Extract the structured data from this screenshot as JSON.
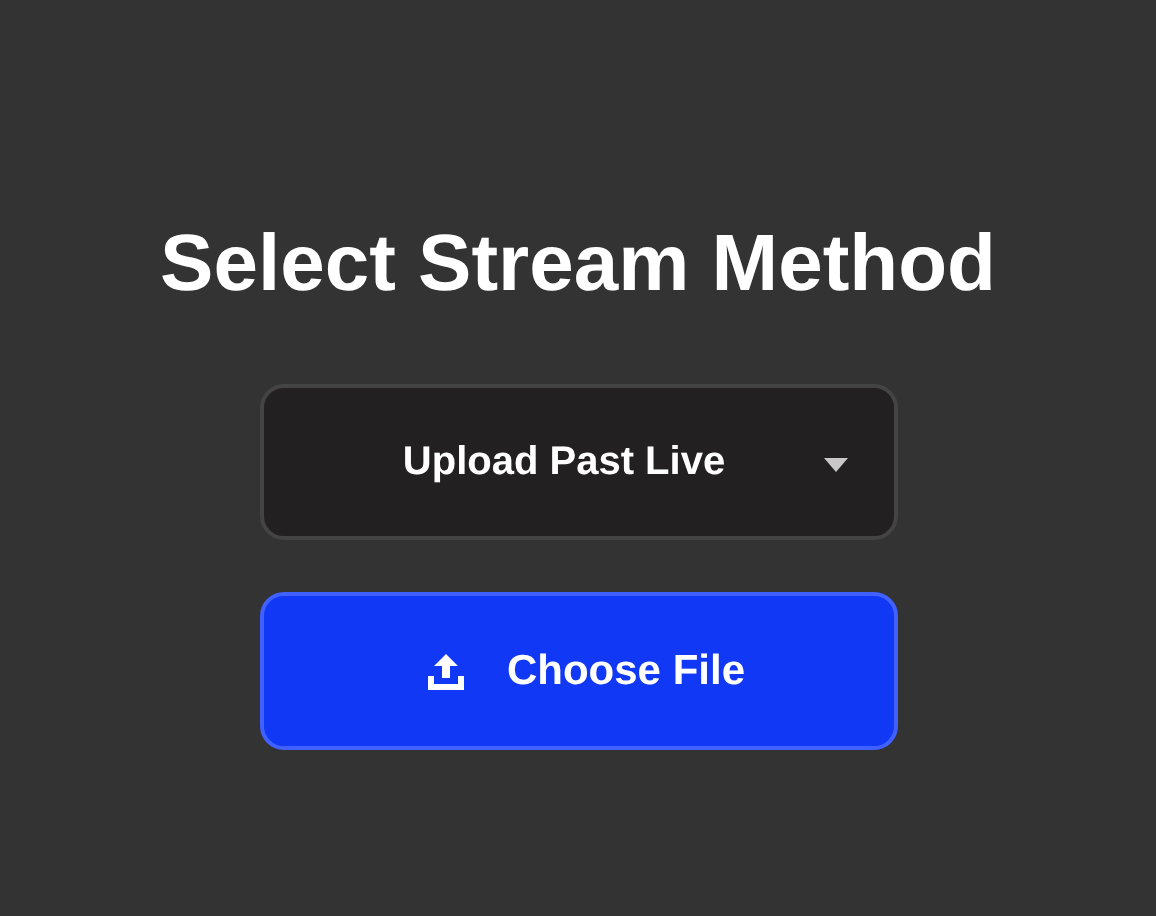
{
  "title": "Select Stream Method",
  "method_select": {
    "value": "Upload Past Live"
  },
  "buttons": [
    {
      "kind": "upload",
      "label": "Choose File"
    }
  ]
}
